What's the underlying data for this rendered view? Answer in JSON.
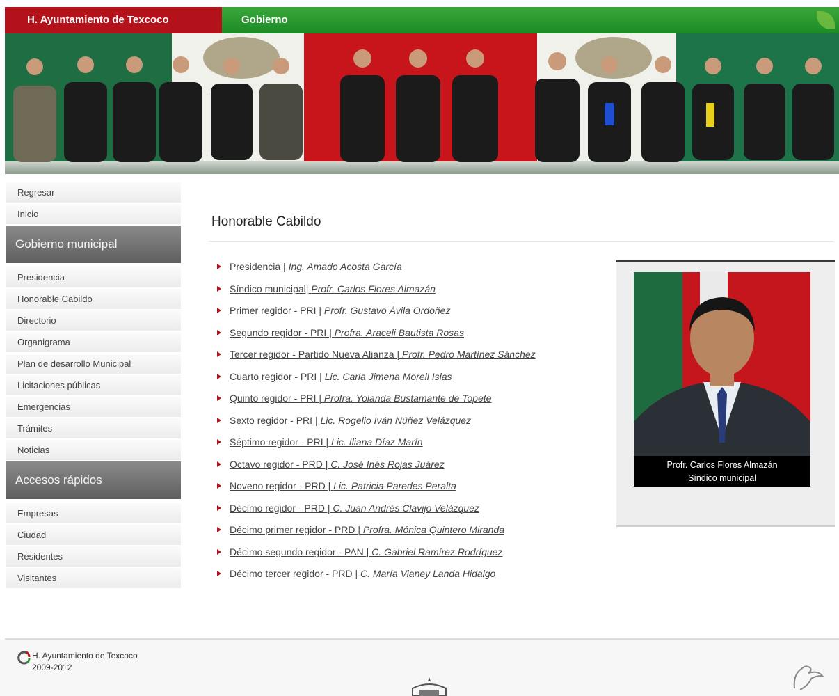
{
  "header": {
    "site_title": "H. Ayuntamiento de Texcoco",
    "section": "Gobierno"
  },
  "sidebar": {
    "top_items": [
      "Regresar",
      "Inicio"
    ],
    "group1_title": "Gobierno municipal",
    "group1_items": [
      "Presidencia",
      "Honorable Cabildo",
      "Directorio",
      "Organigrama",
      "Plan de desarrollo Municipal",
      "Licitaciones públicas",
      "Emergencias",
      "Trámites",
      "Noticias"
    ],
    "group2_title": "Accesos rápidos",
    "group2_items": [
      "Empresas",
      "Ciudad",
      "Residentes",
      "Visitantes"
    ]
  },
  "main": {
    "title": "Honorable Cabildo",
    "members": [
      {
        "role": "Presidencia | ",
        "name": "Ing. Amado Acosta García"
      },
      {
        "role": "Síndico municipal| ",
        "name": "Profr. Carlos Flores Almazán"
      },
      {
        "role": "Primer regidor - PRI | ",
        "name": "Profr. Gustavo Ávila Ordoñez"
      },
      {
        "role": "Segundo regidor - PRI | ",
        "name": "Profra. Araceli Bautista Rosas"
      },
      {
        "role": "Tercer regidor - Partido Nueva Alianza | ",
        "name": "Profr. Pedro Martínez Sánchez"
      },
      {
        "role": "Cuarto regidor - PRI | ",
        "name": "Lic. Carla Jimena Morell Islas"
      },
      {
        "role": "Quinto regidor - PRI | ",
        "name": "Profra. Yolanda Bustamante de Topete"
      },
      {
        "role": "Sexto regidor - PRI | ",
        "name": "Lic. Rogelio Iván Núñez Velázquez"
      },
      {
        "role": "Séptimo regidor - PRI | ",
        "name": "Lic. Iliana Díaz Marín"
      },
      {
        "role": "Octavo regidor - PRD | ",
        "name": "C. José Inés Rojas Juárez"
      },
      {
        "role": "Noveno regidor - PRD | ",
        "name": "Lic. Patricia Paredes Peralta"
      },
      {
        "role": "Décimo regidor - PRD | ",
        "name": "C. Juan Andrés Clavijo Velázquez"
      },
      {
        "role": "Décimo primer regidor - PRD | ",
        "name": "Profra. Mónica Quintero Miranda"
      },
      {
        "role": "Décimo segundo regidor - PAN | ",
        "name": "C. Gabriel Ramírez Rodríguez"
      },
      {
        "role": "Décimo tercer regidor - PRD | ",
        "name": "C. María Vianey Landa Hidalgo"
      }
    ],
    "photo_caption_name": "Profr. Carlos Flores Almazán",
    "photo_caption_role": "Síndico municipal"
  },
  "footer": {
    "org": "H. Ayuntamiento de Texcoco",
    "years": "2009-2012"
  },
  "colors": {
    "brand_red": "#b3121a",
    "brand_green": "#2a9a30",
    "sidebar_header": "#6e6e6e"
  },
  "icons": [
    "bullet-arrow-icon",
    "footer-logo-icon",
    "municipal-emblem-icon",
    "bird-logo-icon"
  ]
}
